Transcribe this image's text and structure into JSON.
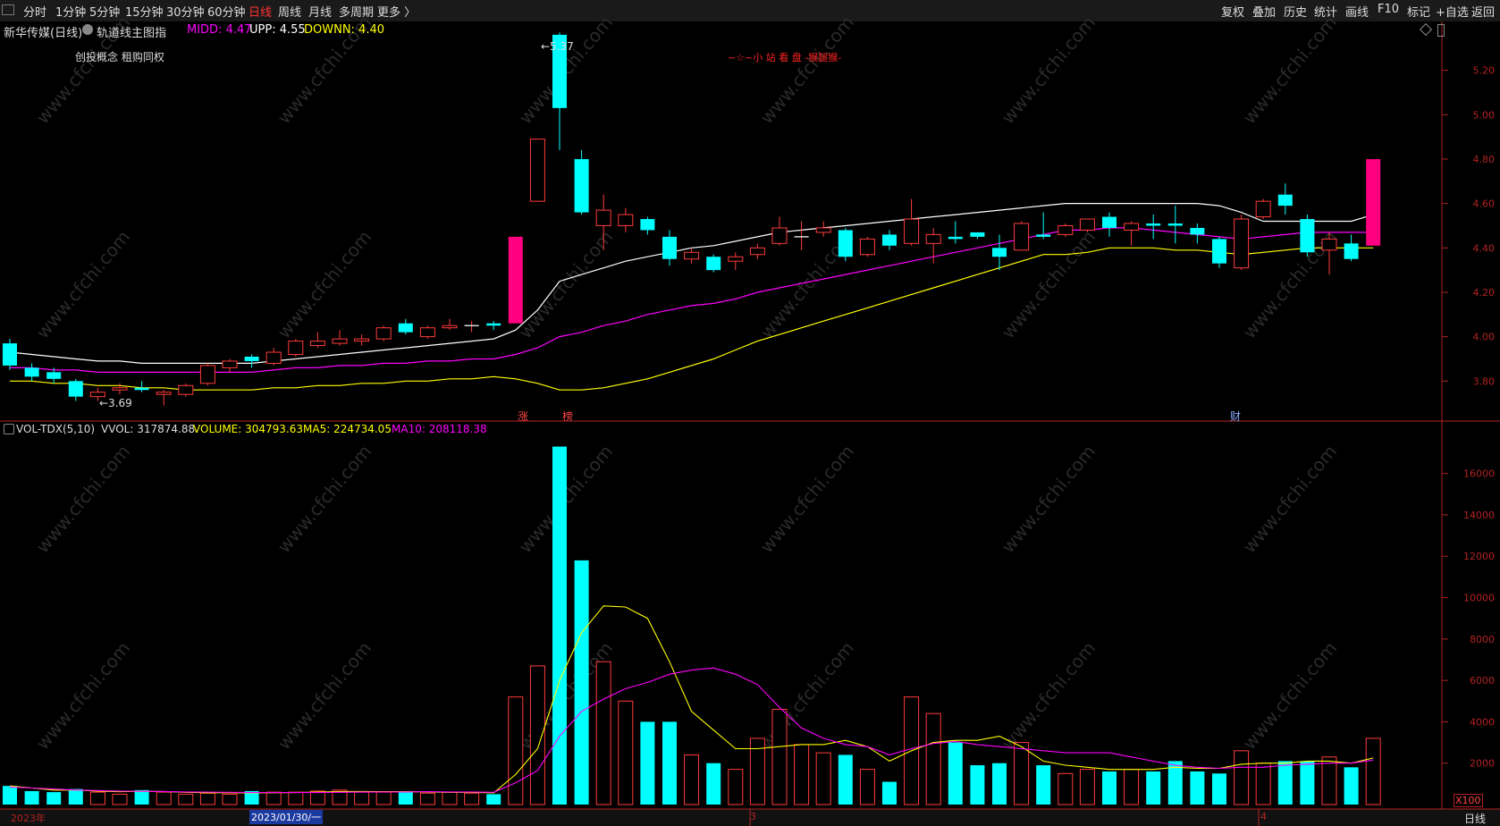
{
  "toolbar": {
    "left": [
      "分时",
      "1分钟",
      "5分钟",
      "15分钟",
      "30分钟",
      "60分钟",
      "日线",
      "周线",
      "月线",
      "多周期",
      "更多 〉"
    ],
    "active": "日线",
    "right": [
      "复权",
      "叠加",
      "历史",
      "统计",
      "画线",
      "F10",
      "标记",
      "+自选",
      "返回"
    ]
  },
  "main_panel": {
    "stock_title": "新华传媒(日线)",
    "indicator_name": "轨道线主图指",
    "midd_label": "MIDD: 4.47",
    "upp_label": "UPP: 4.55",
    "downn_label": "DOWNN: 4.40",
    "concepts": "创投概念 租购同权",
    "banner": "~☆~小 站 看 盘 -猴腿猴-",
    "high_label": "←5.37",
    "low_label": "←3.69",
    "markers": [
      "涨",
      "榜",
      "财"
    ],
    "icons": [
      "diamond-icon",
      "scroll-icon"
    ],
    "colors": {
      "up": "#ff3b3b",
      "down": "#00ffff",
      "upp": "#ffffff",
      "midd": "#ff00ff",
      "downn": "#ffff00",
      "pink": "#ff0080",
      "axis": "#b22222"
    }
  },
  "vol_panel": {
    "indicator_name": "VOL-TDX(5,10)",
    "vvol_label": "VVOL: 317874.88",
    "volume_label": "VOLUME: 304793.63",
    "ma5_label": "MA5: 224734.05",
    "ma10_label": "MA10: 208118.38",
    "unit": "X100"
  },
  "date_axis": {
    "labels": [
      "2023年",
      "2023/01/30/一",
      "3",
      "4"
    ],
    "period": "日线"
  },
  "chart_data": [
    {
      "type": "candlestick",
      "title": "新华传媒(日线)",
      "ylim": [
        3.62,
        5.42
      ],
      "yticks": [
        3.8,
        4.0,
        4.2,
        4.4,
        4.6,
        4.8,
        5.0,
        5.2
      ],
      "ohlc": [
        [
          3.97,
          3.99,
          3.85,
          3.87
        ],
        [
          3.86,
          3.88,
          3.8,
          3.82
        ],
        [
          3.84,
          3.86,
          3.79,
          3.81
        ],
        [
          3.8,
          3.81,
          3.71,
          3.73
        ],
        [
          3.73,
          3.77,
          3.71,
          3.75
        ],
        [
          3.76,
          3.79,
          3.74,
          3.77
        ],
        [
          3.77,
          3.8,
          3.75,
          3.76
        ],
        [
          3.74,
          3.76,
          3.69,
          3.75
        ],
        [
          3.74,
          3.79,
          3.73,
          3.78
        ],
        [
          3.79,
          3.88,
          3.78,
          3.87
        ],
        [
          3.86,
          3.9,
          3.84,
          3.89
        ],
        [
          3.91,
          3.92,
          3.86,
          3.89
        ],
        [
          3.88,
          3.95,
          3.87,
          3.93
        ],
        [
          3.92,
          3.99,
          3.91,
          3.98
        ],
        [
          3.96,
          4.02,
          3.95,
          3.98
        ],
        [
          3.97,
          4.03,
          3.96,
          3.99
        ],
        [
          3.98,
          4.01,
          3.96,
          3.99
        ],
        [
          3.99,
          4.05,
          3.98,
          4.04
        ],
        [
          4.06,
          4.08,
          4.01,
          4.02
        ],
        [
          4.0,
          4.05,
          3.99,
          4.04
        ],
        [
          4.04,
          4.08,
          4.03,
          4.05
        ],
        [
          4.05,
          4.07,
          4.02,
          4.05
        ],
        [
          4.06,
          4.07,
          4.03,
          4.05
        ],
        [
          4.06,
          4.45,
          4.06,
          4.45
        ],
        [
          4.61,
          4.89,
          4.61,
          4.89
        ],
        [
          5.36,
          5.37,
          4.84,
          5.03
        ],
        [
          4.8,
          4.84,
          4.55,
          4.56
        ],
        [
          4.5,
          4.64,
          4.39,
          4.57
        ],
        [
          4.5,
          4.58,
          4.47,
          4.55
        ],
        [
          4.53,
          4.54,
          4.46,
          4.48
        ],
        [
          4.45,
          4.48,
          4.32,
          4.35
        ],
        [
          4.35,
          4.4,
          4.33,
          4.38
        ],
        [
          4.36,
          4.37,
          4.29,
          4.3
        ],
        [
          4.34,
          4.38,
          4.3,
          4.36
        ],
        [
          4.37,
          4.42,
          4.35,
          4.4
        ],
        [
          4.42,
          4.54,
          4.41,
          4.49
        ],
        [
          4.45,
          4.52,
          4.39,
          4.45
        ],
        [
          4.47,
          4.52,
          4.45,
          4.49
        ],
        [
          4.48,
          4.49,
          4.34,
          4.36
        ],
        [
          4.37,
          4.45,
          4.36,
          4.44
        ],
        [
          4.46,
          4.48,
          4.39,
          4.41
        ],
        [
          4.42,
          4.62,
          4.41,
          4.53
        ],
        [
          4.42,
          4.49,
          4.33,
          4.46
        ],
        [
          4.45,
          4.52,
          4.42,
          4.44
        ],
        [
          4.47,
          4.47,
          4.44,
          4.45
        ],
        [
          4.4,
          4.46,
          4.3,
          4.36
        ],
        [
          4.39,
          4.52,
          4.39,
          4.51
        ],
        [
          4.46,
          4.56,
          4.44,
          4.45
        ],
        [
          4.46,
          4.51,
          4.45,
          4.5
        ],
        [
          4.48,
          4.53,
          4.47,
          4.53
        ],
        [
          4.54,
          4.56,
          4.45,
          4.49
        ],
        [
          4.48,
          4.52,
          4.41,
          4.51
        ],
        [
          4.51,
          4.55,
          4.44,
          4.5
        ],
        [
          4.51,
          4.59,
          4.42,
          4.5
        ],
        [
          4.49,
          4.51,
          4.42,
          4.46
        ],
        [
          4.44,
          4.45,
          4.31,
          4.33
        ],
        [
          4.31,
          4.55,
          4.3,
          4.53
        ],
        [
          4.54,
          4.62,
          4.53,
          4.61
        ],
        [
          4.64,
          4.69,
          4.55,
          4.59
        ],
        [
          4.53,
          4.55,
          4.36,
          4.38
        ],
        [
          4.39,
          4.47,
          4.28,
          4.44
        ],
        [
          4.42,
          4.46,
          4.34,
          4.35
        ],
        [
          4.41,
          4.8,
          4.41,
          4.8
        ]
      ],
      "series": [
        {
          "name": "UPP",
          "values": [
            3.93,
            3.92,
            3.91,
            3.9,
            3.89,
            3.89,
            3.88,
            3.88,
            3.88,
            3.88,
            3.88,
            3.88,
            3.89,
            3.9,
            3.91,
            3.92,
            3.93,
            3.94,
            3.95,
            3.96,
            3.97,
            3.98,
            3.99,
            4.03,
            4.12,
            4.25,
            4.28,
            4.31,
            4.34,
            4.36,
            4.38,
            4.4,
            4.41,
            4.43,
            4.45,
            4.47,
            4.48,
            4.49,
            4.5,
            4.51,
            4.52,
            4.53,
            4.54,
            4.55,
            4.56,
            4.57,
            4.58,
            4.59,
            4.6,
            4.6,
            4.6,
            4.6,
            4.6,
            4.6,
            4.6,
            4.59,
            4.56,
            4.52,
            4.52,
            4.52,
            4.52,
            4.52,
            4.55
          ]
        },
        {
          "name": "MIDD",
          "values": [
            3.86,
            3.86,
            3.85,
            3.85,
            3.84,
            3.84,
            3.84,
            3.84,
            3.84,
            3.84,
            3.84,
            3.84,
            3.85,
            3.86,
            3.86,
            3.87,
            3.87,
            3.88,
            3.88,
            3.89,
            3.89,
            3.9,
            3.9,
            3.92,
            3.95,
            4.0,
            4.02,
            4.05,
            4.07,
            4.1,
            4.12,
            4.14,
            4.15,
            4.17,
            4.2,
            4.22,
            4.24,
            4.26,
            4.28,
            4.3,
            4.32,
            4.34,
            4.36,
            4.38,
            4.4,
            4.42,
            4.44,
            4.46,
            4.48,
            4.48,
            4.49,
            4.49,
            4.48,
            4.47,
            4.46,
            4.45,
            4.44,
            4.45,
            4.46,
            4.47,
            4.47,
            4.47,
            4.47
          ]
        },
        {
          "name": "DOWNN",
          "values": [
            3.8,
            3.8,
            3.79,
            3.79,
            3.78,
            3.78,
            3.77,
            3.77,
            3.76,
            3.76,
            3.76,
            3.76,
            3.77,
            3.77,
            3.78,
            3.78,
            3.79,
            3.79,
            3.8,
            3.8,
            3.81,
            3.81,
            3.82,
            3.81,
            3.79,
            3.76,
            3.76,
            3.77,
            3.79,
            3.81,
            3.84,
            3.87,
            3.9,
            3.94,
            3.98,
            4.01,
            4.04,
            4.07,
            4.1,
            4.13,
            4.16,
            4.19,
            4.22,
            4.25,
            4.28,
            4.31,
            4.34,
            4.37,
            4.37,
            4.38,
            4.4,
            4.4,
            4.4,
            4.39,
            4.39,
            4.38,
            4.37,
            4.38,
            4.39,
            4.4,
            4.4,
            4.4,
            4.4
          ]
        }
      ]
    },
    {
      "type": "bar",
      "title": "VOL-TDX(5,10)",
      "unit": "X100",
      "ylim": [
        0,
        17800
      ],
      "yticks": [
        2000,
        4000,
        6000,
        8000,
        10000,
        12000,
        14000,
        16000
      ],
      "values": [
        900,
        650,
        600,
        750,
        600,
        500,
        700,
        600,
        500,
        550,
        500,
        650,
        600,
        600,
        650,
        700,
        600,
        600,
        650,
        550,
        600,
        550,
        500,
        5200,
        6700,
        17300,
        11800,
        6900,
        5000,
        4000,
        4000,
        2400,
        2000,
        1700,
        3200,
        4600,
        2900,
        2500,
        2400,
        1700,
        1100,
        5200,
        4400,
        3000,
        1900,
        2000,
        3000,
        1900,
        1500,
        1700,
        1600,
        1700,
        1600,
        2100,
        1600,
        1500,
        2600,
        2000,
        2100,
        2100,
        2300,
        1800,
        3200
      ],
      "series": [
        {
          "name": "MA5",
          "values": [
            900,
            800,
            700,
            700,
            650,
            620,
            640,
            630,
            590,
            570,
            570,
            560,
            570,
            580,
            600,
            630,
            630,
            620,
            620,
            610,
            590,
            590,
            560,
            1450,
            2700,
            6000,
            8300,
            9600,
            9550,
            9000,
            6900,
            4500,
            3600,
            2700,
            2700,
            2800,
            2900,
            2900,
            3100,
            2800,
            2100,
            2600,
            3000,
            3100,
            3100,
            3300,
            2800,
            2100,
            1900,
            1800,
            1700,
            1700,
            1700,
            1800,
            1750,
            1750,
            1950,
            2000,
            2000,
            2100,
            2100,
            2000,
            2250
          ]
        },
        {
          "name": "MA10",
          "values": [
            850,
            800,
            750,
            700,
            680,
            650,
            640,
            630,
            610,
            600,
            590,
            580,
            580,
            580,
            580,
            590,
            600,
            610,
            610,
            620,
            610,
            610,
            590,
            1050,
            1650,
            3300,
            4500,
            5100,
            5600,
            5900,
            6300,
            6500,
            6600,
            6300,
            5800,
            4700,
            3700,
            3200,
            2900,
            2800,
            2400,
            2700,
            2950,
            3050,
            2900,
            2800,
            2700,
            2600,
            2500,
            2500,
            2500,
            2300,
            2100,
            1900,
            1800,
            1750,
            1800,
            1800,
            1900,
            1950,
            2000,
            2000,
            2150
          ]
        }
      ]
    }
  ]
}
